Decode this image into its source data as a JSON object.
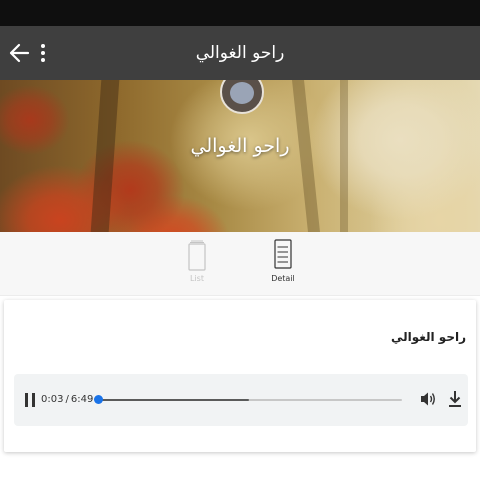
{
  "app_bar": {
    "title": "راحو الغوالي",
    "back_icon": "arrow-back-icon",
    "menu_icon": "more-vert-icon"
  },
  "header": {
    "artist_name": "راحو الغوالي",
    "avatar_icon": "avatar"
  },
  "tabs": [
    {
      "label": "List",
      "icon": "list-icon",
      "selected": false
    },
    {
      "label": "Detail",
      "icon": "detail-icon",
      "selected": true
    }
  ],
  "track": {
    "title": "راحو الغوالي"
  },
  "player": {
    "current_time": "0:03",
    "separator": "/",
    "duration": "6:49",
    "played_fraction": 0.007,
    "buffered_fraction": 0.5,
    "pause_icon": "pause-icon",
    "volume_icon": "volume-icon",
    "download_icon": "download-icon",
    "accent_color": "#1a73e8"
  },
  "colors": {
    "app_bar": "#3f3f3f",
    "status_bar": "#0f0f0f",
    "tab_selected": "#333333",
    "tab_unselected": "#c4c4c4"
  }
}
